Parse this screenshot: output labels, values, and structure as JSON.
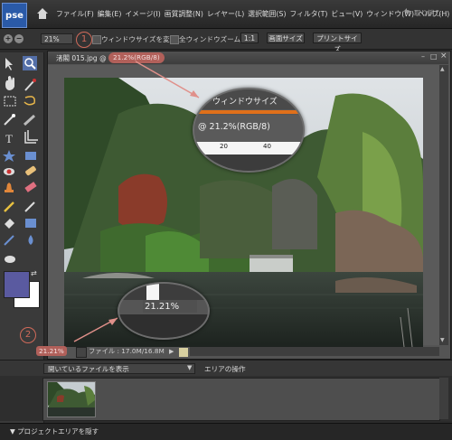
{
  "app": {
    "logo_text": "pse"
  },
  "menu": {
    "items": [
      "ファイル(F)",
      "編集(E)",
      "イメージ(I)",
      "画質調整(N)",
      "レイヤー(L)",
      "選択範囲(S)",
      "フィルタ(T)",
      "ビュー(V)",
      "ウィンドウ(W)",
      "ヘルプ(H)"
    ],
    "undo_label": "取り消し"
  },
  "options": {
    "zoom_value": "21%",
    "resize_window_label": "ウィンドウサイズを変更",
    "zoom_all_label": "全ウィンドウズーム",
    "one_to_one_label": "1:1",
    "screen_size_label": "画面サイズ",
    "print_size_label": "プリントサイズ"
  },
  "callouts": {
    "one": "1",
    "two": "2"
  },
  "document": {
    "title": "渚閣 015.jpg @",
    "mode": "21.2%(RGB/8)",
    "status_zoom": "21.21%",
    "file_size": "ファイル : 17.0M/16.8M"
  },
  "magnifier1": {
    "top_text": "ウィンドウサイズ",
    "mode_text": "@ 21.2%(RGB/8)",
    "ruler_labels": [
      "20",
      "40"
    ]
  },
  "magnifier2": {
    "zoom_text": "21.21%"
  },
  "bin": {
    "select_value": "開いているファイルを表示",
    "area_operation_label": "エリアの操作"
  },
  "bottom": {
    "hide_project_label": "プロジェクトエリアを隠す"
  },
  "colors": {
    "accent_red": "#b1605a",
    "callout": "#d06a5a",
    "foreground": "#5a5aa0",
    "background": "#ffffff"
  }
}
